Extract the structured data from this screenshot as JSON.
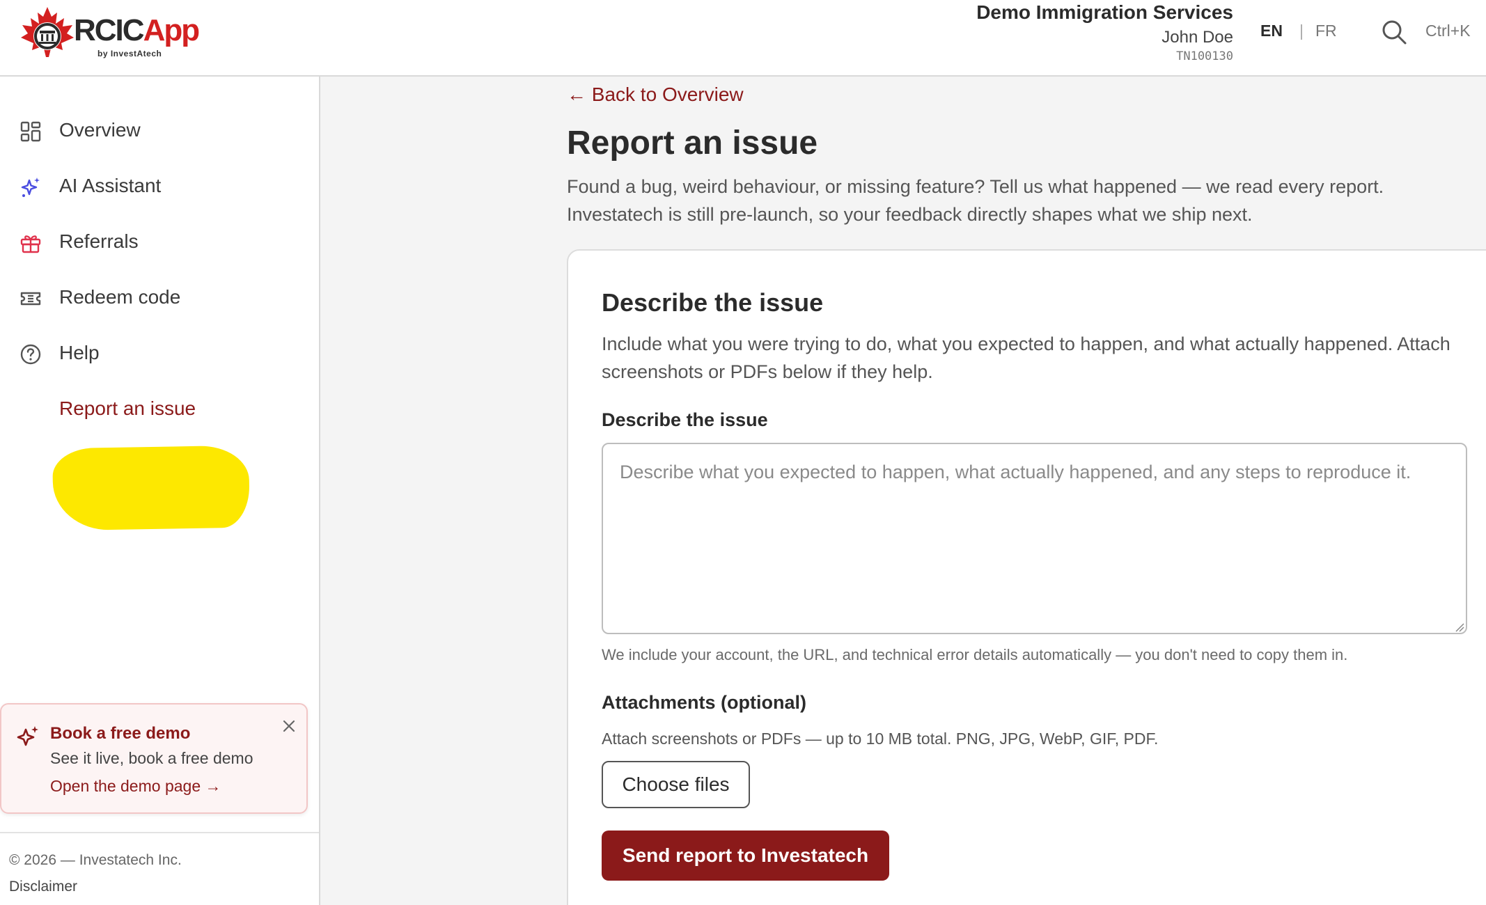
{
  "app": {
    "logo_rcic": "RCIC",
    "logo_app": "App",
    "logo_sub": "by InvestAtech"
  },
  "header": {
    "org_name": "Demo Immigration Services",
    "user_name": "John Doe",
    "user_id": "TN100130",
    "lang_en": "EN",
    "lang_sep": "|",
    "lang_fr": "FR",
    "search_shortcut": "Ctrl+K"
  },
  "sidebar": {
    "items": [
      {
        "label": "Overview",
        "icon": "grid-icon"
      },
      {
        "label": "AI Assistant",
        "icon": "sparkle-icon"
      },
      {
        "label": "Referrals",
        "icon": "gift-icon"
      },
      {
        "label": "Redeem code",
        "icon": "ticket-icon"
      },
      {
        "label": "Help",
        "icon": "help-circle-icon"
      },
      {
        "label": "Report an issue",
        "icon": "warning-triangle-icon",
        "active": true
      }
    ],
    "demo_card": {
      "title": "Book a free demo",
      "subtitle": "See it live, book a free demo",
      "link": "Open the demo page →"
    },
    "copyright": "© 2026 — Investatech Inc.",
    "disclaimer": "Disclaimer"
  },
  "main": {
    "back_link": "← Back to Overview",
    "title": "Report an issue",
    "description": "Found a bug, weird behaviour, or missing feature? Tell us what happened — we read every report. Investatech is still pre-launch, so your feedback directly shapes what we ship next.",
    "card": {
      "title": "Describe the issue",
      "description": "Include what you were trying to do, what you expected to happen, and what actually happened. Attach screenshots or PDFs below if they help.",
      "field_label": "Describe the issue",
      "field_value": "",
      "field_placeholder": "Describe what you expected to happen, what actually happened, and any steps to reproduce it.",
      "helper_text": "We include your account, the URL, and technical error details automatically — you don't need to copy them in.",
      "attachments_label": "Attachments (optional)",
      "attachments_help": "Attach screenshots or PDFs — up to 10 MB total. PNG, JPG, WebP, GIF, PDF.",
      "choose_files_label": "Choose files",
      "submit_label": "Send report to Investatech"
    }
  },
  "colors": {
    "brand": "#8b1a1a",
    "logo_red": "#d32020",
    "active_bg": "#fbeeee",
    "highlight": "#fde800",
    "ai_icon": "#4a4de0",
    "gift_icon": "#e0314b"
  }
}
